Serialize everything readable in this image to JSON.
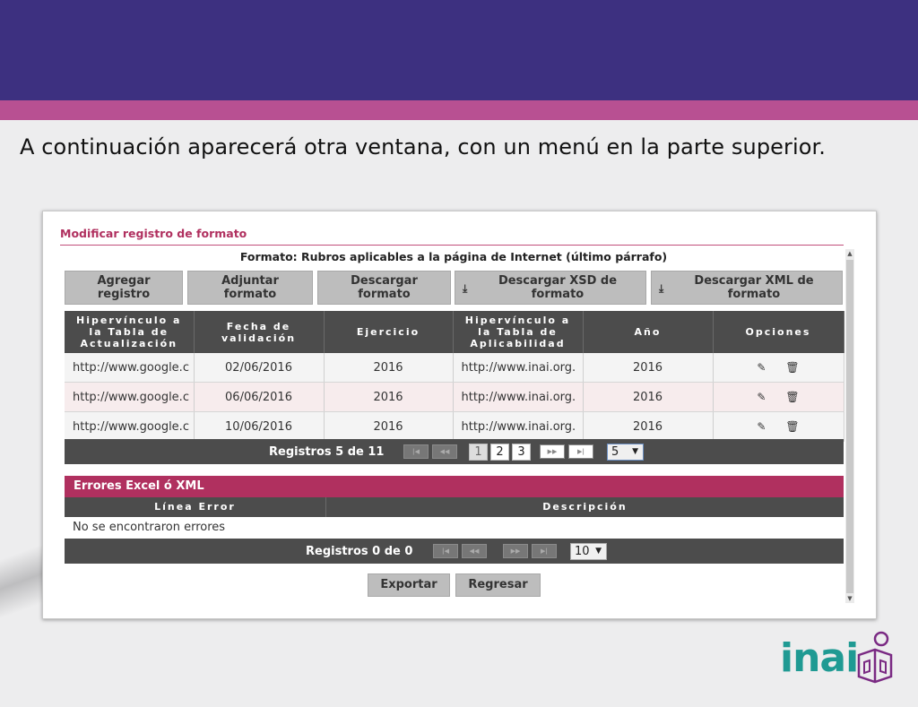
{
  "slide": {
    "caption": "A continuación aparecerá otra ventana, con un menú en la parte superior.",
    "logo_text": "inai"
  },
  "window": {
    "title": "Modificar registro de formato",
    "format_title": "Formato: Rubros aplicables a la página de Internet (último párrafo)",
    "buttons": {
      "agregar": "Agregar registro",
      "adjuntar": "Adjuntar formato",
      "descargar": "Descargar formato",
      "descargar_xsd": "Descargar XSD de formato",
      "descargar_xml": "Descargar XML de formato"
    },
    "table": {
      "headers": [
        "Hipervínculo a la Tabla de Actualización",
        "Fecha de validación",
        "Ejercicio",
        "Hipervínculo a la Tabla de Aplicabilidad",
        "Año",
        "Opciones"
      ],
      "rows": [
        {
          "hipervinculo_actualizacion": "http://www.google.c",
          "fecha": "02/06/2016",
          "ejercicio": "2016",
          "hipervinculo_aplicabilidad": "http://www.inai.org.",
          "anio": "2016"
        },
        {
          "hipervinculo_actualizacion": "http://www.google.c",
          "fecha": "06/06/2016",
          "ejercicio": "2016",
          "hipervinculo_aplicabilidad": "http://www.inai.org.",
          "anio": "2016"
        },
        {
          "hipervinculo_actualizacion": "http://www.google.c",
          "fecha": "10/06/2016",
          "ejercicio": "2016",
          "hipervinculo_aplicabilidad": "http://www.inai.org.",
          "anio": "2016"
        }
      ],
      "row_icons": [
        "pencil-icon",
        "trash-icon"
      ]
    },
    "pager": {
      "info": "Registros 5 de 11",
      "pages": [
        "1",
        "2",
        "3"
      ],
      "current_page": "1",
      "page_size": "5"
    },
    "errors": {
      "title": "Errores Excel ó XML",
      "headers": [
        "Línea Error",
        "Descripción"
      ],
      "empty_message": "No se encontraron errores",
      "pager_info": "Registros 0 de 0",
      "page_size": "10"
    },
    "actions": {
      "exportar": "Exportar",
      "regresar": "Regresar"
    }
  },
  "colors": {
    "banner": "#3d3080",
    "stripe": "#b85092",
    "accent": "#b0305f",
    "header_dark": "#4c4c4c",
    "logo": "#1f9a93"
  }
}
